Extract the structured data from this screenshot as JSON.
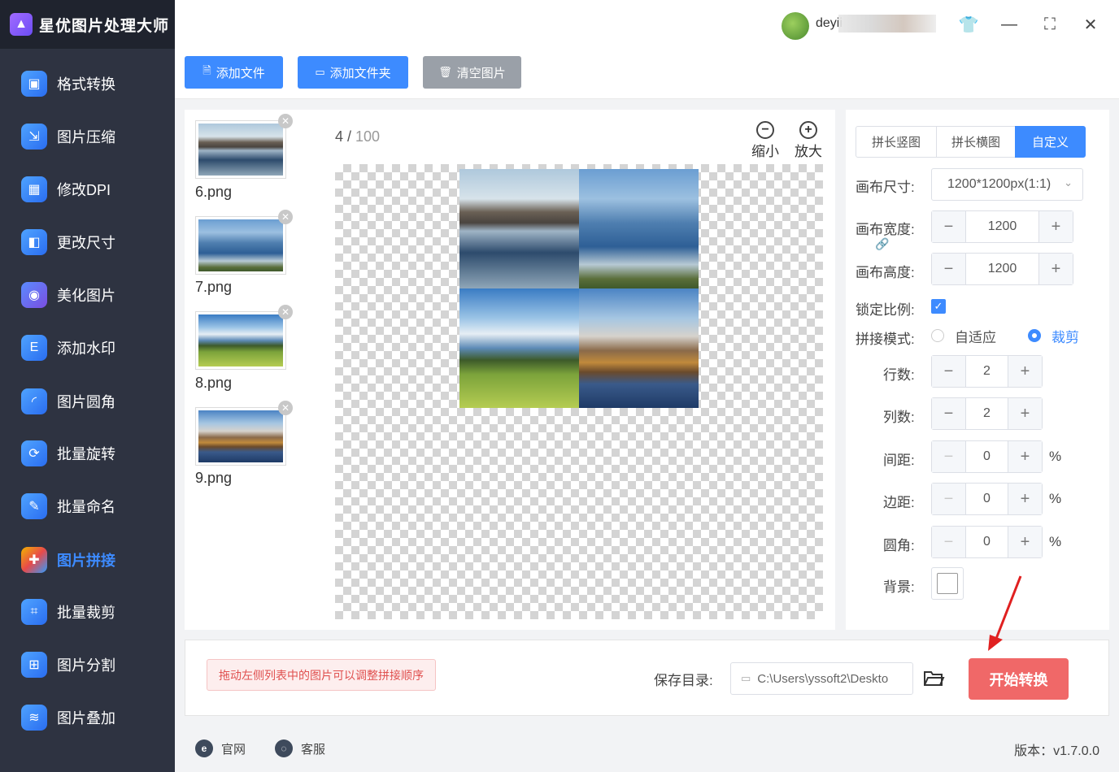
{
  "app": {
    "title": "星优图片处理大师",
    "logo_icon": "image-icon"
  },
  "user": {
    "name": "deyii"
  },
  "sidebar": {
    "items": [
      {
        "label": "格式转换",
        "icon": "image-convert-icon",
        "active": false
      },
      {
        "label": "图片压缩",
        "icon": "compress-icon",
        "active": false
      },
      {
        "label": "修改DPI",
        "icon": "dpi-icon",
        "active": false
      },
      {
        "label": "更改尺寸",
        "icon": "resize-icon",
        "active": false
      },
      {
        "label": "美化图片",
        "icon": "beautify-icon",
        "active": false
      },
      {
        "label": "添加水印",
        "icon": "watermark-icon",
        "active": false
      },
      {
        "label": "图片圆角",
        "icon": "round-corner-icon",
        "active": false
      },
      {
        "label": "批量旋转",
        "icon": "rotate-icon",
        "active": false
      },
      {
        "label": "批量命名",
        "icon": "rename-icon",
        "active": false
      },
      {
        "label": "图片拼接",
        "icon": "puzzle-icon",
        "active": true
      },
      {
        "label": "批量裁剪",
        "icon": "crop-icon",
        "active": false
      },
      {
        "label": "图片分割",
        "icon": "split-icon",
        "active": false
      },
      {
        "label": "图片叠加",
        "icon": "layers-icon",
        "active": false
      }
    ]
  },
  "toolbar": {
    "add_file": "添加文件",
    "add_folder": "添加文件夹",
    "clear": "清空图片"
  },
  "files": [
    {
      "name": "6.png"
    },
    {
      "name": "7.png"
    },
    {
      "name": "8.png"
    },
    {
      "name": "9.png"
    }
  ],
  "preview": {
    "current": "4",
    "separator": " / ",
    "total": "100",
    "zoom_out": "缩小",
    "zoom_in": "放大"
  },
  "settings": {
    "tabs": [
      "拼长竖图",
      "拼长横图",
      "自定义"
    ],
    "active_tab": "自定义",
    "canvas_size_label": "画布尺寸:",
    "canvas_size_value": "1200*1200px(1:1)",
    "canvas_width_label": "画布宽度:",
    "canvas_width": "1200",
    "canvas_height_label": "画布高度:",
    "canvas_height": "1200",
    "lock_ratio_label": "锁定比例:",
    "lock_ratio": true,
    "mode_label": "拼接模式:",
    "mode_fit": "自适应",
    "mode_crop": "裁剪",
    "mode_selected": "裁剪",
    "rows_label": "行数:",
    "rows": "2",
    "cols_label": "列数:",
    "cols": "2",
    "spacing_label": "间距:",
    "spacing": "0",
    "margin_label": "边距:",
    "margin": "0",
    "radius_label": "圆角:",
    "radius": "0",
    "percent": "%",
    "background_label": "背景:",
    "background_color": "#ffffff"
  },
  "bottom": {
    "hint": "拖动左侧列表中的图片可以调整拼接顺序",
    "save_label": "保存目录:",
    "save_path": "C:\\Users\\yssoft2\\Deskto",
    "start": "开始转换"
  },
  "footer": {
    "website": "官网",
    "support": "客服",
    "version": "版本：v1.7.0.0"
  },
  "colors": {
    "accent": "#3d8bff",
    "start_button": "#f06868",
    "sidebar_bg": "#2e3341",
    "arrow": "#e02020"
  }
}
